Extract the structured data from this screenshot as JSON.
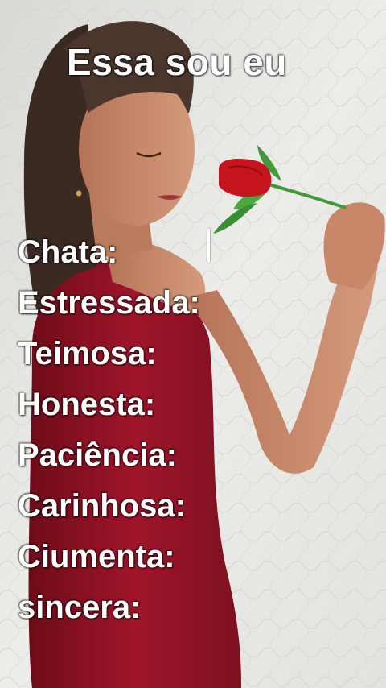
{
  "title": "Essa sou eu",
  "traits": [
    "Chata:",
    "Estressada:",
    "Teimosa:",
    "Honesta:",
    "Paciência:",
    "Carinhosa:",
    "Ciumenta:",
    "sincera:"
  ],
  "colors": {
    "text": "#ffffff",
    "wall": "#e9e9e7",
    "dress": "#a0152a",
    "rose": "#c4141e",
    "stem": "#3f9a3a"
  }
}
